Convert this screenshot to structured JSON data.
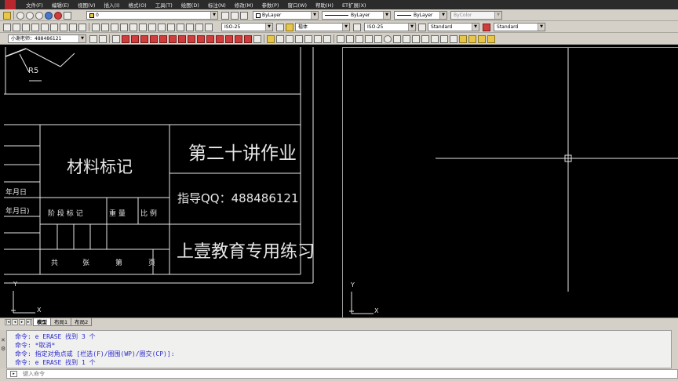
{
  "menu": {
    "items": [
      "文件(F)",
      "编辑(E)",
      "视图(V)",
      "插入(I)",
      "格式(O)",
      "工具(T)",
      "绘图(D)",
      "标注(N)",
      "修改(M)",
      "参数(P)",
      "窗口(W)",
      "帮助(H)",
      "ET扩展(X)"
    ]
  },
  "toolbar": {
    "layer_value": "0",
    "color_value": "ByLayer",
    "linetype_value": "ByLayer",
    "lineweight_value": "ByLayer",
    "plotstyle_value": "ByColor",
    "dimstyle_value_1": "ISO-25",
    "textfont_value": "楷体",
    "dimstyle_value_2": "ISO-25",
    "tablestyle_value": "Standard",
    "mleaderstyle_value": "Standard",
    "workspace_value": "小谢老师：488486121"
  },
  "drawing": {
    "radius_label": "R5",
    "title_block": {
      "material_label": "材料标记",
      "title": "第二十讲作业",
      "qq_line": "指导QQ：488486121",
      "org": "上壹教育专用练习",
      "stage_label": "阶 段 标 记",
      "weight_label": "重   量",
      "scale_label": "比  例",
      "total_label": "共",
      "sheet_label": "张",
      "num_label": "第",
      "page_label": "页",
      "date_label_1": "年月日",
      "date_label_2": "年月日)"
    },
    "ucs_y": "Y",
    "ucs_x": "X"
  },
  "tabs": {
    "items": [
      "模型",
      "布局1",
      "布局2"
    ],
    "active": 0
  },
  "command": {
    "history": [
      "命令: e ERASE 找到 3 个",
      "命令: *取消*",
      "命令: 指定对角点或 [栏选(F)/圈围(WP)/圈交(CP)]:",
      "命令: e ERASE 找到 1 个"
    ],
    "input_placeholder": "键入命令"
  },
  "colors": {
    "background": "#000000",
    "line": "#e6e6e6",
    "command_text": "#2a2ad0",
    "chrome": "#d4d0c8"
  }
}
